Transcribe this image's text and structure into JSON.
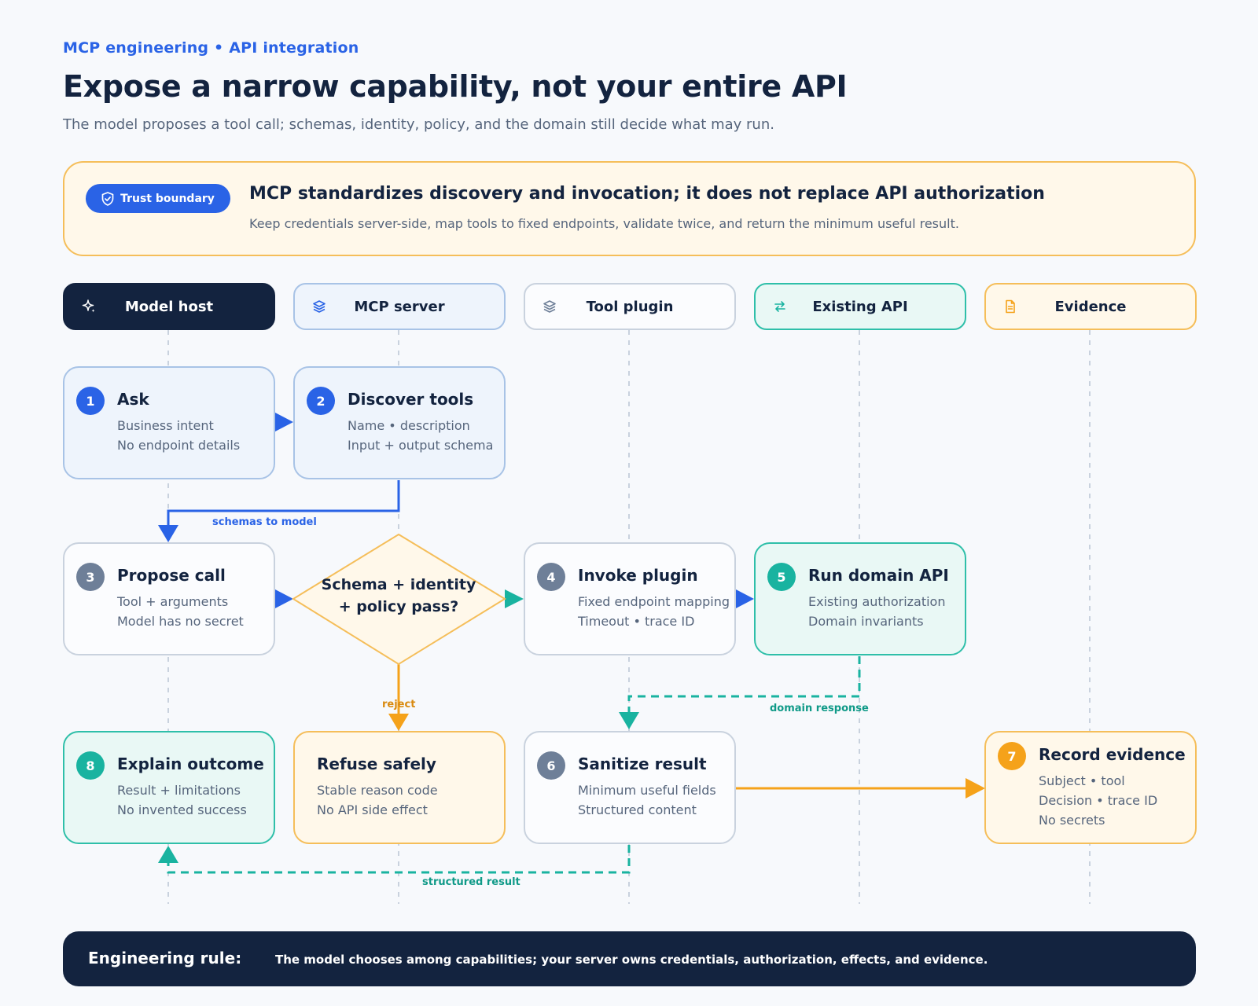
{
  "header": {
    "eyebrow": "MCP engineering • API integration",
    "title": "Expose a narrow capability, not your entire API",
    "subtitle": "The model proposes a tool call; schemas, identity, policy, and the domain still decide what may run."
  },
  "callout": {
    "pill": "Trust boundary",
    "pill_icon": "shield-check-icon",
    "heading": "MCP standardizes discovery and invocation; it does not replace API authorization",
    "text": "Keep credentials server-side, map tools to fixed endpoints, validate twice, and return the minimum useful result."
  },
  "lanes": [
    {
      "label": "Model host",
      "icon": "sparkle-icon"
    },
    {
      "label": "MCP server",
      "icon": "layers-icon"
    },
    {
      "label": "Tool plugin",
      "icon": "layers-icon"
    },
    {
      "label": "Existing API",
      "icon": "arrows-exchange-icon"
    },
    {
      "label": "Evidence",
      "icon": "document-icon"
    }
  ],
  "nodes": {
    "ask": {
      "num": "1",
      "title": "Ask",
      "lines": [
        "Business intent",
        "No endpoint details"
      ]
    },
    "discover": {
      "num": "2",
      "title": "Discover tools",
      "lines": [
        "Name • description",
        "Input + output schema"
      ]
    },
    "propose": {
      "num": "3",
      "title": "Propose call",
      "lines": [
        "Tool + arguments",
        "Model has no secret"
      ]
    },
    "decision": {
      "text": "Schema + identity + policy pass?"
    },
    "invoke": {
      "num": "4",
      "title": "Invoke plugin",
      "lines": [
        "Fixed endpoint mapping",
        "Timeout • trace ID"
      ]
    },
    "run": {
      "num": "5",
      "title": "Run domain API",
      "lines": [
        "Existing authorization",
        "Domain invariants"
      ]
    },
    "explain": {
      "num": "8",
      "title": "Explain outcome",
      "lines": [
        "Result + limitations",
        "No invented success"
      ]
    },
    "refuse": {
      "title": "Refuse safely",
      "lines": [
        "Stable reason code",
        "No API side effect"
      ]
    },
    "sanitize": {
      "num": "6",
      "title": "Sanitize result",
      "lines": [
        "Minimum useful fields",
        "Structured content"
      ]
    },
    "record": {
      "num": "7",
      "title": "Record evidence",
      "lines": [
        "Subject • tool",
        "Decision • trace ID",
        "No secrets"
      ]
    }
  },
  "edges": {
    "schemas": "schemas to model",
    "reject": "reject",
    "domain": "domain response",
    "structured": "structured result"
  },
  "footer": {
    "label": "Engineering rule:",
    "text": "The model chooses among capabilities; your server owns credentials, authorization, effects, and evidence."
  },
  "colors": {
    "blue": "#2a63e6",
    "navy": "#13233f",
    "teal": "#19b3a0",
    "amber": "#f5a21a",
    "slate": "#6e7f98"
  }
}
